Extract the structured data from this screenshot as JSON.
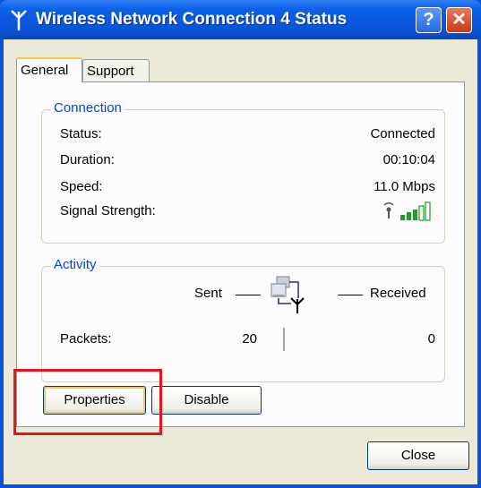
{
  "window": {
    "title": "Wireless Network Connection 4 Status",
    "help_label": "?",
    "close_label": "✕"
  },
  "tabs": [
    {
      "label": "General",
      "selected": true
    },
    {
      "label": "Support",
      "selected": false
    }
  ],
  "connection": {
    "legend": "Connection",
    "rows": [
      {
        "label": "Status:",
        "value": "Connected"
      },
      {
        "label": "Duration:",
        "value": "00:10:04"
      },
      {
        "label": "Speed:",
        "value": "11.0 Mbps"
      },
      {
        "label": "Signal Strength:",
        "value_icon": "signal-strength-icon",
        "bars_filled": 3,
        "bars_total": 5
      }
    ]
  },
  "activity": {
    "legend": "Activity",
    "sent_label": "Sent",
    "received_label": "Received",
    "packets_label": "Packets:",
    "packets_sent": "20",
    "packets_received": "0"
  },
  "buttons": {
    "properties": "Properties",
    "disable": "Disable",
    "close": "Close"
  },
  "colors": {
    "titlebar": "#0a55d8",
    "legend_text": "#0046d5",
    "highlight": "#e8141b",
    "signal": "#1aa31a"
  }
}
